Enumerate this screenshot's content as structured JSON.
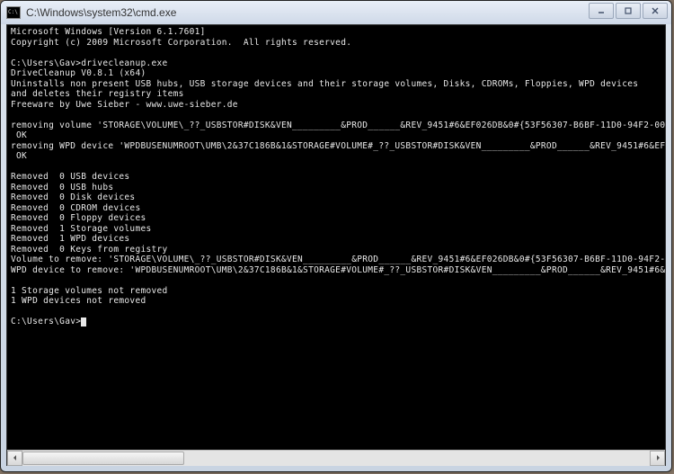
{
  "window": {
    "title": "C:\\Windows\\system32\\cmd.exe"
  },
  "console": {
    "lines": [
      "Microsoft Windows [Version 6.1.7601]",
      "Copyright (c) 2009 Microsoft Corporation.  All rights reserved.",
      "",
      "C:\\Users\\Gav>drivecleanup.exe",
      "DriveCleanup V0.8.1 (x64)",
      "Uninstalls non present USB hubs, USB storage devices and their storage volumes, Disks, CDROMs, Floppies, WPD devices",
      "and deletes their registry items",
      "Freeware by Uwe Sieber - www.uwe-sieber.de",
      "",
      "removing volume 'STORAGE\\VOLUME\\_??_USBSTOR#DISK&VEN_________&PROD______&REV_9451#6&EF026DB&0#{53F56307-B6BF-11D0-94F2-00",
      " OK",
      "removing WPD device 'WPDBUSENUMROOT\\UMB\\2&37C186B&1&STORAGE#VOLUME#_??_USBSTOR#DISK&VEN_________&PROD______&REV_9451#6&EF",
      " OK",
      "",
      "Removed  0 USB devices",
      "Removed  0 USB hubs",
      "Removed  0 Disk devices",
      "Removed  0 CDROM devices",
      "Removed  0 Floppy devices",
      "Removed  1 Storage volumes",
      "Removed  1 WPD devices",
      "Removed  0 Keys from registry",
      "Volume to remove: 'STORAGE\\VOLUME\\_??_USBSTOR#DISK&VEN_________&PROD______&REV_9451#6&EF026DB&0#{53F56307-B6BF-11D0-94F2-",
      "WPD device to remove: 'WPDBUSENUMROOT\\UMB\\2&37C186B&1&STORAGE#VOLUME#_??_USBSTOR#DISK&VEN_________&PROD______&REV_9451#6&",
      "",
      "1 Storage volumes not removed",
      "1 WPD devices not removed",
      "",
      ""
    ],
    "prompt": "C:\\Users\\Gav>"
  },
  "controls": {
    "minimize": "minimize",
    "maximize": "maximize",
    "close": "close"
  }
}
